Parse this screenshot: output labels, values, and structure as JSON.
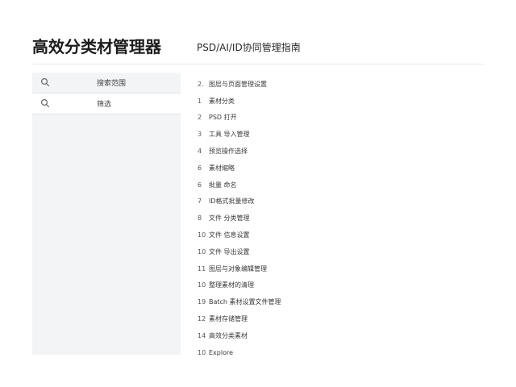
{
  "header": {
    "title": "高效分类材管理器",
    "subtitle": "PSD/AI/ID协同管理指南"
  },
  "sidebar": {
    "rows": [
      {
        "icon": "search-icon",
        "label": "搜索范围"
      },
      {
        "icon": "search-icon",
        "label": "筛选"
      }
    ]
  },
  "list": {
    "items": [
      {
        "num": "2.",
        "text": "图层与页面管理设置"
      },
      {
        "num": "1",
        "text": "素材分类"
      },
      {
        "num": "2",
        "text": "PSD 打开"
      },
      {
        "num": "3",
        "text": "工具 导入管理"
      },
      {
        "num": "4",
        "text": "预览操作选择"
      },
      {
        "num": "6",
        "text": "素材缩略"
      },
      {
        "num": "6",
        "text": "批量 命名"
      },
      {
        "num": "7",
        "text": "ID格式批量修改"
      },
      {
        "num": "8",
        "text": "文件 分类管理"
      },
      {
        "num": "10",
        "text": "文件 信息设置"
      },
      {
        "num": "10",
        "text": "文件 导出设置"
      },
      {
        "num": "11",
        "text": "图层与对象编辑管理"
      },
      {
        "num": "10",
        "text": "整理素材的清理"
      },
      {
        "num": "19",
        "text": "Batch 素材设置文件管理"
      },
      {
        "num": "12",
        "text": "素材存储管理"
      },
      {
        "num": "14",
        "text": "高效分类素材"
      },
      {
        "num": "10",
        "text": "Explore"
      }
    ]
  }
}
